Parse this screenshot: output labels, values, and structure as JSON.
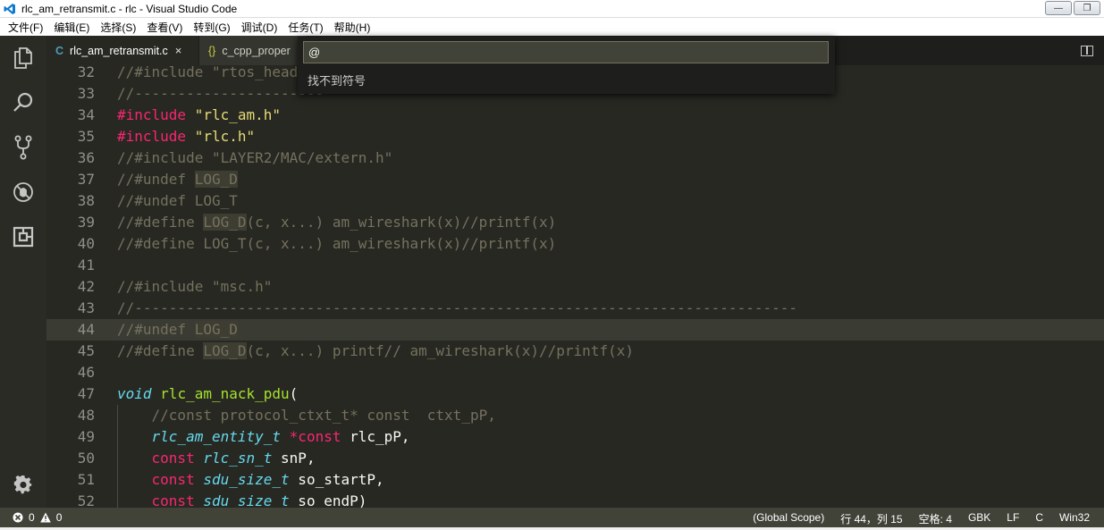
{
  "window": {
    "title": "rlc_am_retransmit.c - rlc - Visual Studio Code",
    "minimize_label": "—",
    "restore_label": "❐",
    "close_label": "✕"
  },
  "menu": [
    "文件(F)",
    "编辑(E)",
    "选择(S)",
    "查看(V)",
    "转到(G)",
    "调试(D)",
    "任务(T)",
    "帮助(H)"
  ],
  "activity_bar": {
    "items": [
      "files-icon",
      "search-icon",
      "source-control-icon",
      "debug-icon",
      "extensions-icon"
    ],
    "settings": "gear-icon"
  },
  "tabs": [
    {
      "icon_text": "C",
      "icon_color": "#519aba",
      "label": "rlc_am_retransmit.c",
      "close": "×",
      "active": true
    },
    {
      "icon_text": "{}",
      "icon_color": "#cbcb41",
      "label": "c_cpp_proper",
      "active": false
    }
  ],
  "quick_pick": {
    "value": "@",
    "message": "找不到符号"
  },
  "editor": {
    "current_line": 44,
    "lines": [
      {
        "n": "32",
        "t": [
          [
            "c-com",
            "//#include \"rtos_head"
          ]
        ]
      },
      {
        "n": "33",
        "t": [
          [
            "c-com",
            "//----------------------"
          ]
        ]
      },
      {
        "n": "34",
        "t": [
          [
            "c-pp",
            "#include "
          ],
          [
            "c-str",
            "\"rlc_am.h\""
          ]
        ]
      },
      {
        "n": "35",
        "t": [
          [
            "c-pp",
            "#include "
          ],
          [
            "c-str",
            "\"rlc.h\""
          ]
        ]
      },
      {
        "n": "36",
        "t": [
          [
            "c-com",
            "//#include \"LAYER2/MAC/extern.h\""
          ]
        ]
      },
      {
        "n": "37",
        "t": [
          [
            "c-com",
            "//#undef "
          ],
          [
            "c-com hl",
            "LOG_D"
          ]
        ]
      },
      {
        "n": "38",
        "t": [
          [
            "c-com",
            "//#undef LOG_T"
          ]
        ]
      },
      {
        "n": "39",
        "t": [
          [
            "c-com",
            "//#define "
          ],
          [
            "c-com hl",
            "LOG_D"
          ],
          [
            "c-com",
            "(c, x...) am_wireshark(x)//printf(x)"
          ]
        ]
      },
      {
        "n": "40",
        "t": [
          [
            "c-com",
            "//#define LOG_T(c, x...) am_wireshark(x)//printf(x)"
          ]
        ]
      },
      {
        "n": "41",
        "t": []
      },
      {
        "n": "42",
        "t": [
          [
            "c-com",
            "//#include \"msc.h\""
          ]
        ]
      },
      {
        "n": "43",
        "t": [
          [
            "c-com",
            "//-----------------------------------------------------------------------------"
          ]
        ]
      },
      {
        "n": "44",
        "t": [
          [
            "c-com",
            "//#undef "
          ],
          [
            "c-com hl",
            "LOG_D"
          ]
        ]
      },
      {
        "n": "45",
        "t": [
          [
            "c-com",
            "//#define "
          ],
          [
            "c-com hl",
            "LOG_D"
          ],
          [
            "c-com",
            "(c, x...) printf// am_wireshark(x)//printf(x)"
          ]
        ]
      },
      {
        "n": "46",
        "t": []
      },
      {
        "n": "47",
        "t": [
          [
            "c-kw",
            "void"
          ],
          [
            "c-pl",
            " "
          ],
          [
            "c-fn",
            "rlc_am_nack_pdu"
          ],
          [
            "c-pl",
            "("
          ]
        ]
      },
      {
        "n": "48",
        "t": [
          [
            "c-pl",
            "    "
          ],
          [
            "c-com",
            "//const protocol_ctxt_t* const  ctxt_pP,"
          ]
        ]
      },
      {
        "n": "49",
        "t": [
          [
            "c-pl",
            "    "
          ],
          [
            "c-ty",
            "rlc_am_entity_t"
          ],
          [
            "c-pl",
            " "
          ],
          [
            "c-kwp",
            "*const"
          ],
          [
            "c-pl",
            " rlc_pP,"
          ]
        ]
      },
      {
        "n": "50",
        "t": [
          [
            "c-pl",
            "    "
          ],
          [
            "c-kwp",
            "const"
          ],
          [
            "c-pl",
            " "
          ],
          [
            "c-ty",
            "rlc_sn_t"
          ],
          [
            "c-pl",
            " snP,"
          ]
        ]
      },
      {
        "n": "51",
        "t": [
          [
            "c-pl",
            "    "
          ],
          [
            "c-kwp",
            "const"
          ],
          [
            "c-pl",
            " "
          ],
          [
            "c-ty",
            "sdu_size_t"
          ],
          [
            "c-pl",
            " so_startP,"
          ]
        ]
      },
      {
        "n": "52",
        "t": [
          [
            "c-pl",
            "    "
          ],
          [
            "c-kwp",
            "const"
          ],
          [
            "c-pl",
            " "
          ],
          [
            "c-ty",
            "sdu_size_t"
          ],
          [
            "c-pl",
            " so_endP)"
          ]
        ]
      }
    ]
  },
  "status": {
    "errors": "0",
    "warnings": "0",
    "scope": "(Global Scope)",
    "position": "行 44，列 15",
    "indent": "空格: 4",
    "encoding": "GBK",
    "eol": "LF",
    "language": "C",
    "platform": "Win32"
  }
}
